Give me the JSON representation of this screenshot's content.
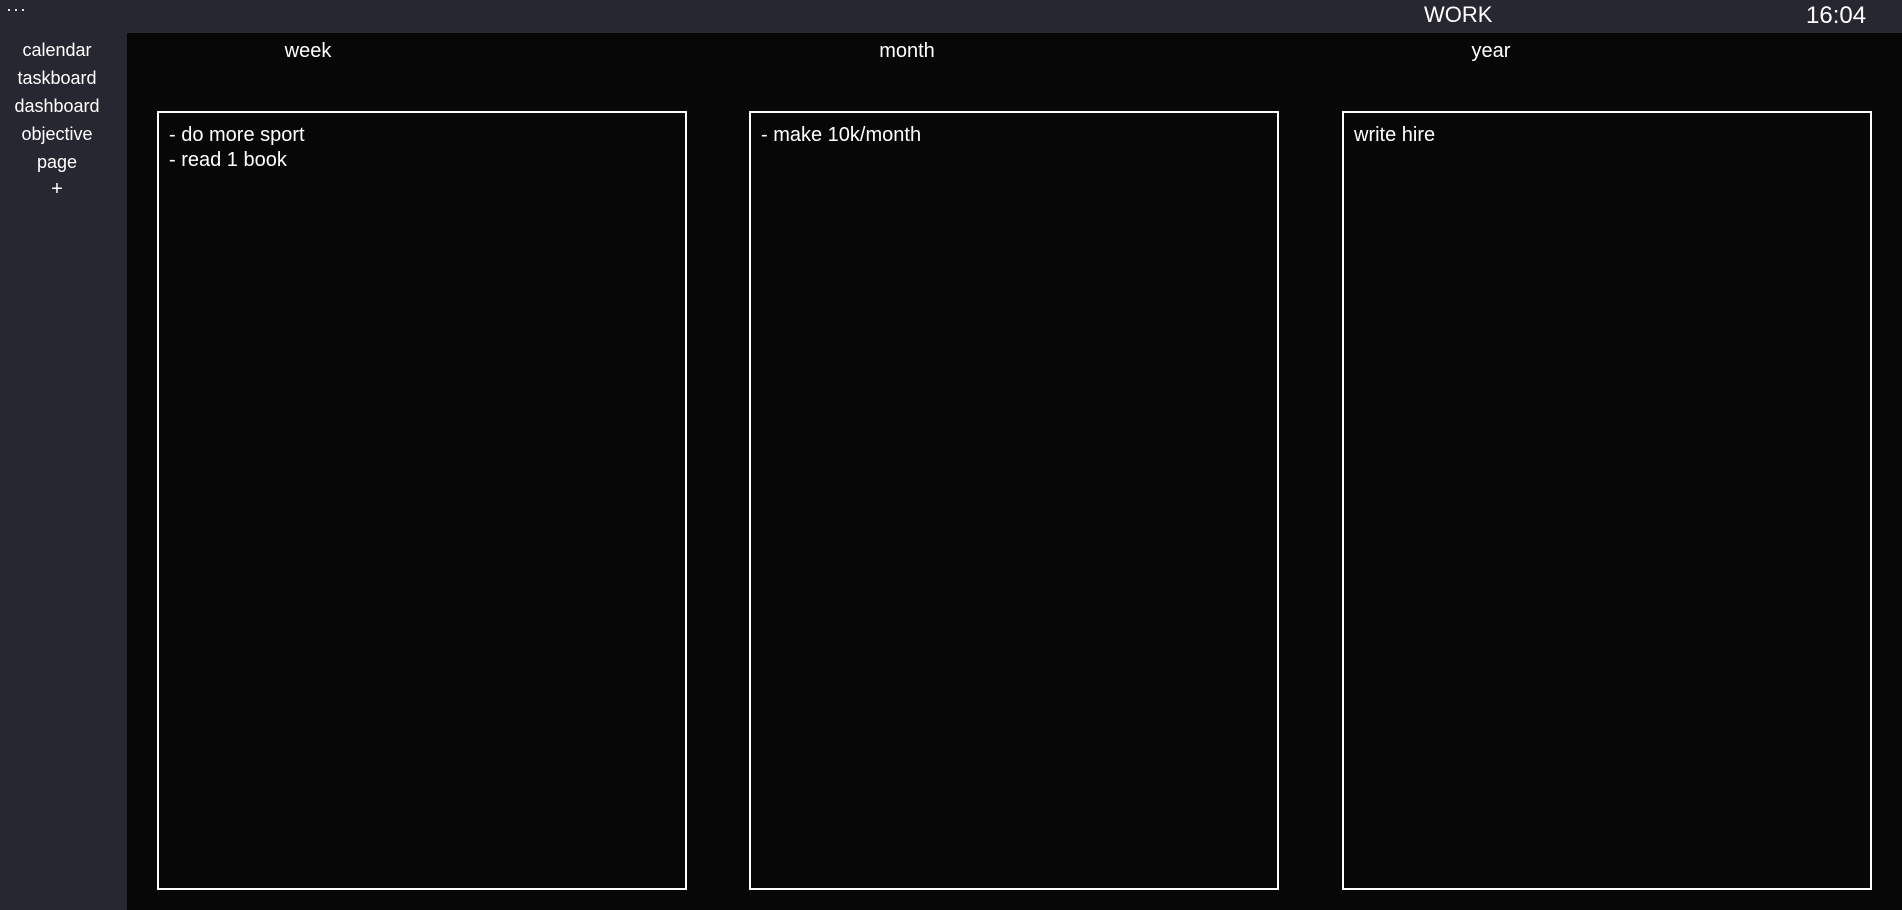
{
  "topbar": {
    "menu_label": "···",
    "title": "WORK",
    "clock": "16:04"
  },
  "sidebar": {
    "items": [
      {
        "label": "calendar"
      },
      {
        "label": "taskboard"
      },
      {
        "label": "dashboard"
      },
      {
        "label": "objective"
      },
      {
        "label": "page"
      }
    ],
    "add_label": "+"
  },
  "columns": [
    {
      "header": "week",
      "lines": [
        "- do more sport",
        "- read 1 book"
      ]
    },
    {
      "header": "month",
      "lines": [
        "- make 10k/month"
      ]
    },
    {
      "header": "year",
      "lines": [
        "write hire"
      ]
    }
  ],
  "colors": {
    "chrome": "#262730",
    "background": "#070708",
    "text": "#ffffff",
    "border": "#ffffff"
  }
}
